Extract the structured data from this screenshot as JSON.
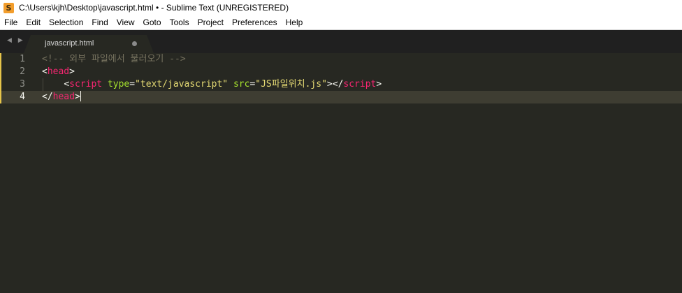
{
  "window": {
    "title": "C:\\Users\\kjh\\Desktop\\javascript.html • - Sublime Text (UNREGISTERED)",
    "app_icon_glyph": "S"
  },
  "menu": {
    "items": [
      "File",
      "Edit",
      "Selection",
      "Find",
      "View",
      "Goto",
      "Tools",
      "Project",
      "Preferences",
      "Help"
    ]
  },
  "tabs": {
    "nav_arrows": "◀ ▶",
    "active": {
      "label": "javascript.html",
      "modified": true
    }
  },
  "editor": {
    "line_numbers": [
      "1",
      "2",
      "3",
      "4"
    ],
    "current_line": 4,
    "lines": [
      {
        "comment": "<!-- 외부 파일에서 불러오기 -->"
      },
      {
        "open": "<",
        "tag": "head",
        "close": ">"
      },
      {
        "indent": "    ",
        "open": "<",
        "tag": "script",
        "attr1": "type",
        "eq1": "=",
        "val1": "\"text/javascript\"",
        "attr2": "src",
        "eq2": "=",
        "val2": "\"JS파일위치.js\"",
        "mid": "></",
        "tag2": "script",
        "close": ">"
      },
      {
        "open": "</",
        "tag": "head",
        "close": ">"
      }
    ]
  },
  "colors": {
    "background": "#272822",
    "comment": "#75715e",
    "tag": "#f92672",
    "attribute": "#a6e22e",
    "string": "#e6db74"
  }
}
